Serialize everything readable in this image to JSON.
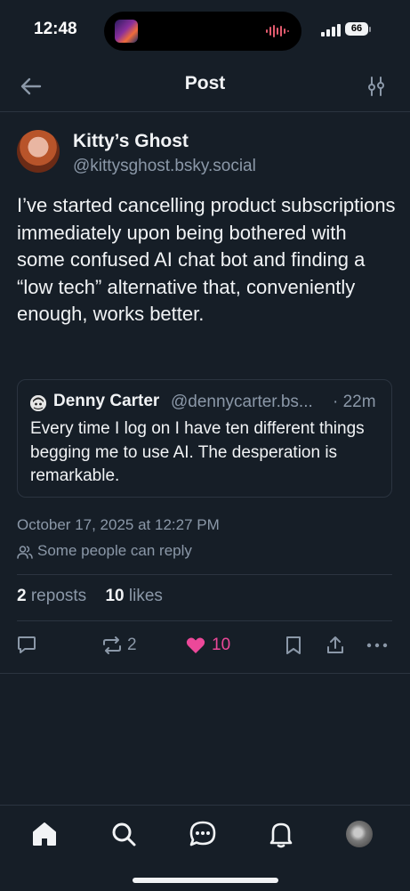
{
  "status_bar": {
    "time": "12:48",
    "battery": "66"
  },
  "header": {
    "title": "Post"
  },
  "post": {
    "author_name": "Kitty’s Ghost",
    "author_handle": "@kittysghost.bsky.social",
    "text": "I’ve started cancelling product subscriptions immediately upon being bothered with some confused AI chat bot and finding a “low tech” alternative that, conveniently enough, works better.",
    "quote": {
      "author_name": "Denny Carter",
      "author_handle": "@dennycarter.bs...",
      "time": "· 22m",
      "text": "Every time I log on I have ten different things begging me to use AI. The desperation is remarkable."
    },
    "date": "October 17, 2025 at 12:27 PM",
    "reply_setting": "Some people can reply",
    "reposts_count": "2",
    "reposts_label": "reposts",
    "likes_count": "10",
    "likes_label": "likes",
    "actions": {
      "repost_count": "2",
      "like_count": "10"
    }
  },
  "colors": {
    "background": "#161e27",
    "muted": "#8b98a8",
    "like": "#ec4899",
    "divider": "#2b3440"
  },
  "icons": [
    "back-arrow-icon",
    "filter-sliders-icon",
    "reply-icon",
    "repost-icon",
    "heart-icon",
    "bookmark-icon",
    "share-icon",
    "more-icon",
    "home-icon",
    "search-icon",
    "chat-icon",
    "bell-icon"
  ]
}
